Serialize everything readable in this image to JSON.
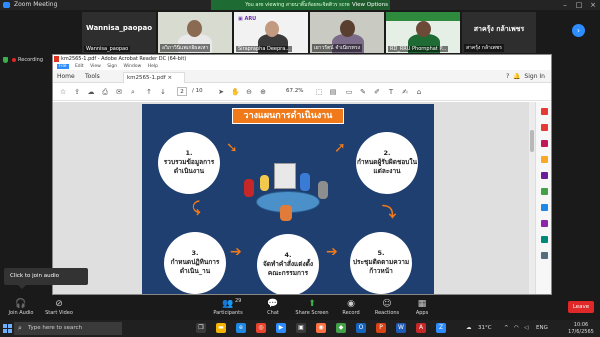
{
  "zoom": {
    "window_title": "Zoom Meeting",
    "banner_text": "You are viewing สายนาติ๊มห้อยทะจิตติวร screen",
    "view_options": "View Options ▾"
  },
  "gallery": {
    "participants": [
      {
        "name": "Wannisa_paopao",
        "center_name": "Wannisa_paopao"
      },
      {
        "name": "อวิภาวินิแพเกอิผลเหา",
        "center_name": ""
      },
      {
        "name": "Siraprapha Deepra...",
        "center_name": ""
      },
      {
        "name": "เยาวรัตน์ จำเนียรทรง",
        "center_name": ""
      },
      {
        "name": "RD_RRU Phornphat P...",
        "center_name": ""
      },
      {
        "name": "สาครุ้ง กล้าเพชร",
        "center_name": "สาครุ้ง กล้าเพชร"
      }
    ],
    "next_icon": "chevron-right-icon"
  },
  "share_bar": {
    "recording_label": "Recording"
  },
  "acrobat": {
    "title": "km2565-1.pdf - Adobe Acrobat Reader DC (64-bit)",
    "menu": [
      "File",
      "Edit",
      "View",
      "Sign",
      "Window",
      "Help"
    ],
    "tabs": {
      "home": "Home",
      "tools": "Tools",
      "file": "km2565-1.pdf"
    },
    "sign_in": "Sign In",
    "page_current": "2",
    "page_total": "/ 10",
    "zoom": "67.2%"
  },
  "slide": {
    "title": "วางแผนการดำเนินงาน",
    "steps": [
      {
        "num": "1.",
        "text": "รวบรวมข้อมูลการดำเนินงาน"
      },
      {
        "num": "2.",
        "text": "กำหนดผู้รับผิดชอบในแต่ละงาน"
      },
      {
        "num": "3.",
        "text": "กำหนดปฏิทินการดำเนิน_าน"
      },
      {
        "num": "4.",
        "text": "จัดทำคำสั่งแต่งตั้งคณะกรรมการ"
      },
      {
        "num": "5.",
        "text": "ประชุมติดตามความก้าวหน้า"
      }
    ]
  },
  "tooltip": {
    "text": "Click to join audio"
  },
  "toolbar": {
    "join_audio": "Join Audio",
    "start_video": "Start Video",
    "participants": "Participants",
    "participants_count": "29",
    "chat": "Chat",
    "share_screen": "Share Screen",
    "record": "Record",
    "reactions": "Reactions",
    "apps": "Apps",
    "leave": "Leave"
  },
  "taskbar": {
    "search_placeholder": "Type here to search",
    "temperature": "31°C",
    "language": "ENG",
    "time": "10:06",
    "date": "17/6/2565"
  },
  "colors": {
    "slide_bg": "#1f3f70",
    "accent_orange": "#f07a1a",
    "zoom_blue": "#2d8cff",
    "leave_red": "#e02828",
    "share_green": "#3ab14a"
  }
}
